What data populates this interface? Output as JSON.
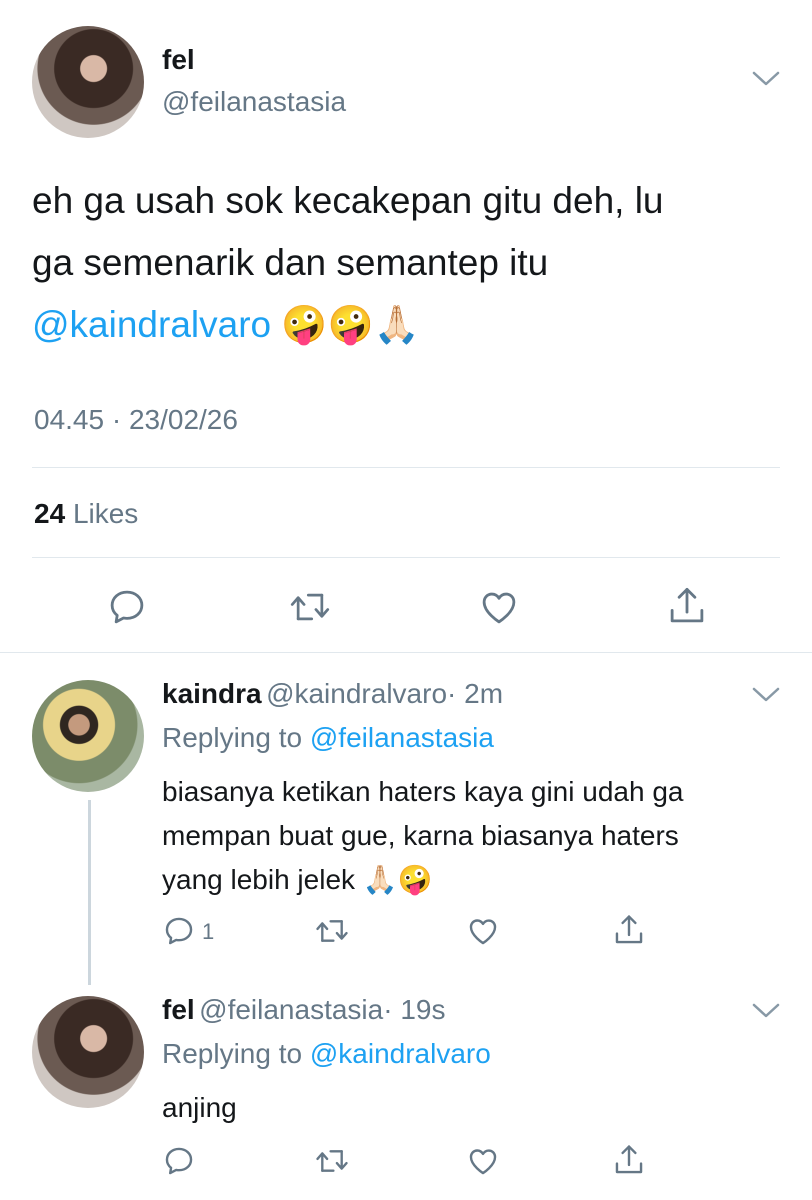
{
  "main_tweet": {
    "name": "fel",
    "handle": "@feilanastasia",
    "text_line1": "eh ga usah sok kecakepan gitu deh, lu",
    "text_line2": "ga semenarik dan semantep itu",
    "mention": "@kaindralvaro",
    "emojis": "🤪🤪🙏🏻",
    "timestamp": "04.45 · 23/02/26",
    "likes_count": "24",
    "likes_label": "Likes"
  },
  "reply1": {
    "name": "kaindra",
    "handle": "@kaindralvaro",
    "time": "· 2m",
    "replying_prefix": "Replying to",
    "replying_handle": "@feilanastasia",
    "text_line1": "biasanya ketikan haters kaya gini udah ga",
    "text_line2": "mempan buat gue, karna biasanya haters",
    "text_line3": "yang lebih jelek",
    "emojis": "🙏🏻🤪",
    "reply_count": "1"
  },
  "reply2": {
    "name": "fel",
    "handle": "@feilanastasia",
    "time": "· 19s",
    "replying_prefix": "Replying to",
    "replying_handle": "@kaindralvaro",
    "text": "anjing"
  },
  "colors": {
    "link": "#1da1f2",
    "secondary": "#657786",
    "divider": "#e1e8ed"
  },
  "icons": [
    "chevron-down-icon",
    "reply-icon",
    "retweet-icon",
    "like-icon",
    "share-icon"
  ]
}
